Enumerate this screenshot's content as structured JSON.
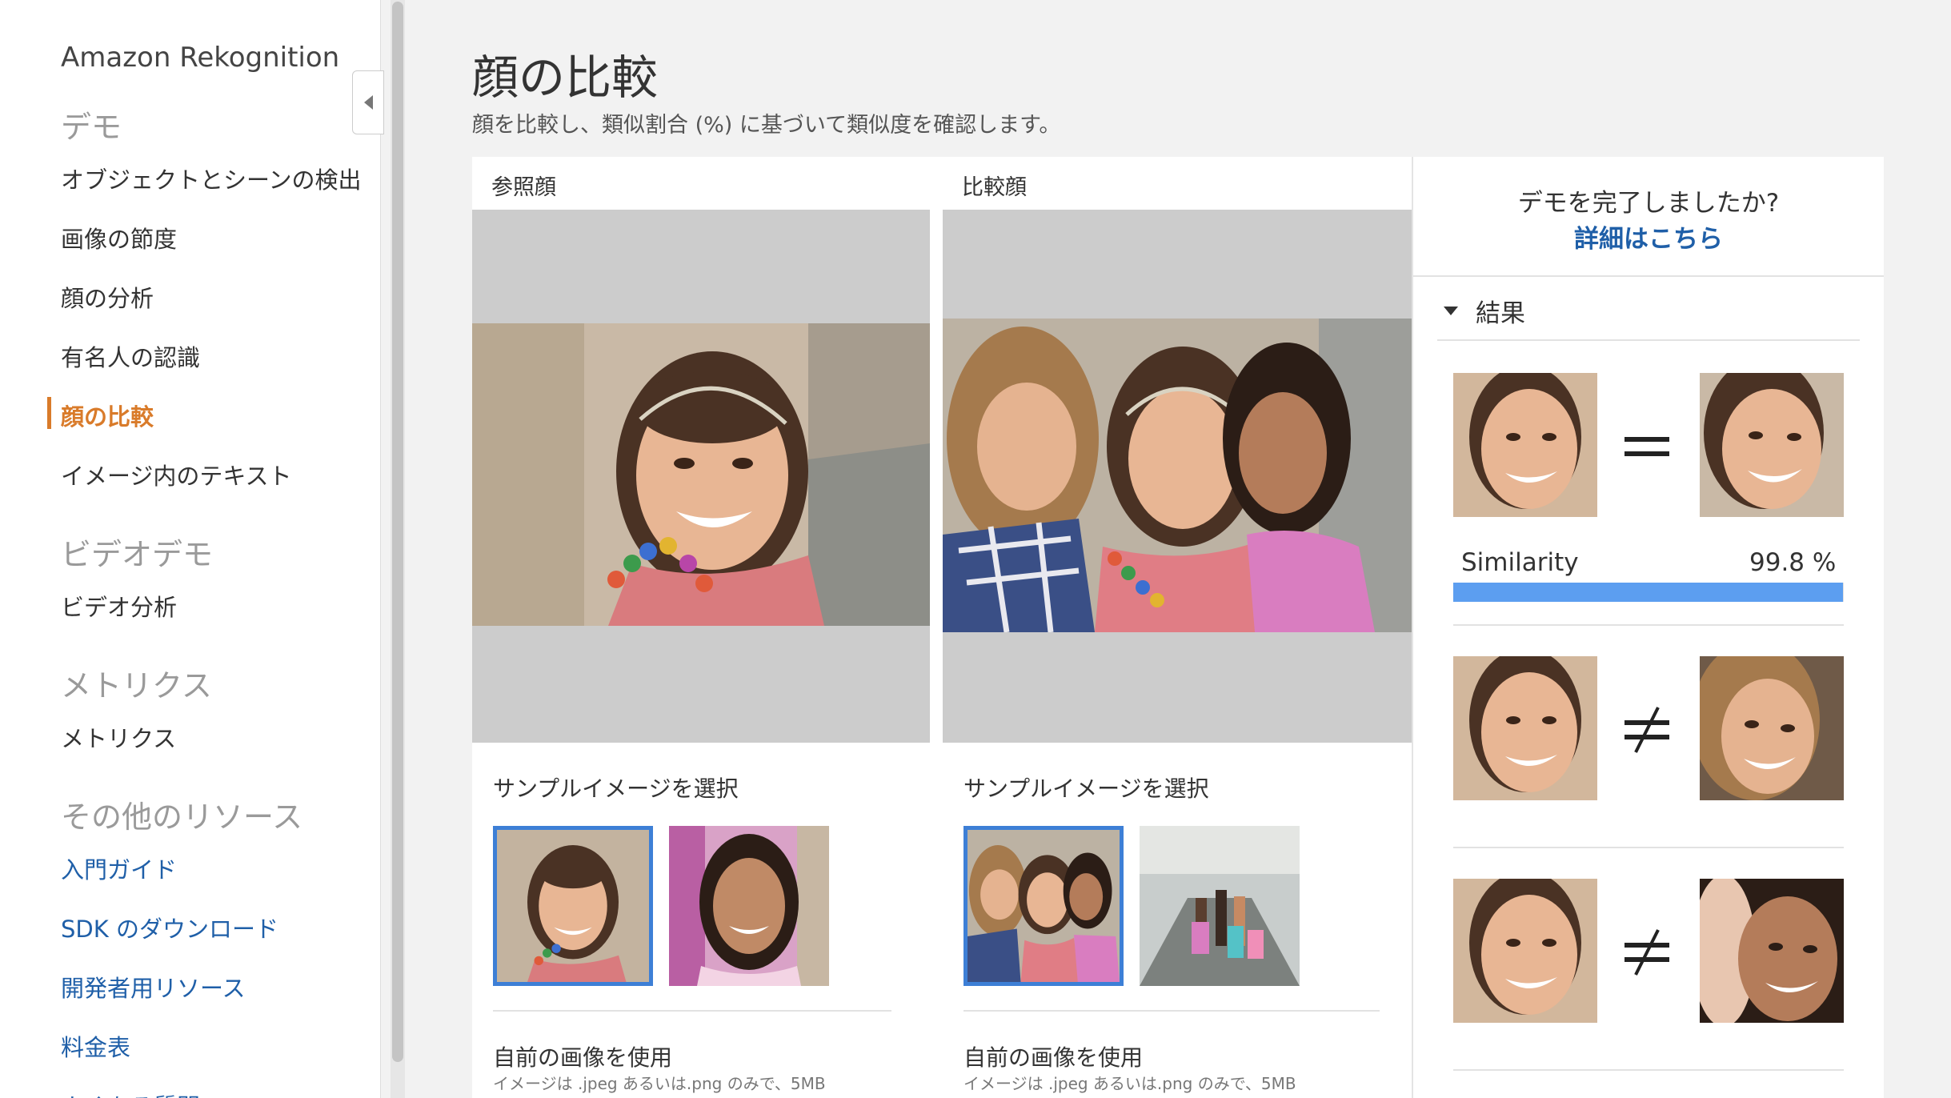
{
  "sidebar": {
    "app_title": "Amazon Rekognition",
    "sections": [
      {
        "title": "デモ",
        "items": [
          "オブジェクトとシーンの検出",
          "画像の節度",
          "顔の分析",
          "有名人の認識",
          "顔の比較",
          "イメージ内のテキスト"
        ]
      },
      {
        "title": "ビデオデモ",
        "items": [
          "ビデオ分析"
        ]
      },
      {
        "title": "メトリクス",
        "items": [
          "メトリクス"
        ]
      },
      {
        "title": "その他のリソース",
        "items": [
          "入門ガイド",
          "SDK のダウンロード",
          "開発者用リソース",
          "料金表",
          "よくある質問"
        ]
      }
    ],
    "active_item": "顔の比較"
  },
  "main": {
    "title": "顔の比較",
    "subtitle": "顔を比較し、類似割合 (%) に基づいて類似度を確認します。",
    "columns": [
      {
        "label": "参照顔",
        "sample_label": "サンプルイメージを選択",
        "own_label": "自前の画像を使用",
        "own_note": "イメージは .jpeg あるいは.png のみで、5MB"
      },
      {
        "label": "比較顔",
        "sample_label": "サンプルイメージを選択",
        "own_label": "自前の画像を使用",
        "own_note": "イメージは .jpeg あるいは.png のみで、5MB"
      }
    ]
  },
  "results": {
    "done_question": "デモを完了しましたか?",
    "done_link": "詳細はこちら",
    "label": "結果",
    "similarity_label": "Similarity",
    "similarity_value": "99.8 %",
    "similarity_fraction": 0.998,
    "matches": [
      {
        "sign": "equals-icon"
      },
      {
        "sign": "not-equal-icon"
      },
      {
        "sign": "not-equal-icon"
      }
    ]
  },
  "colors": {
    "accent": "#d97b2a",
    "link": "#1f5fa8",
    "selection": "#3d7fd6",
    "similarity_bar": "#5c9ef0"
  }
}
